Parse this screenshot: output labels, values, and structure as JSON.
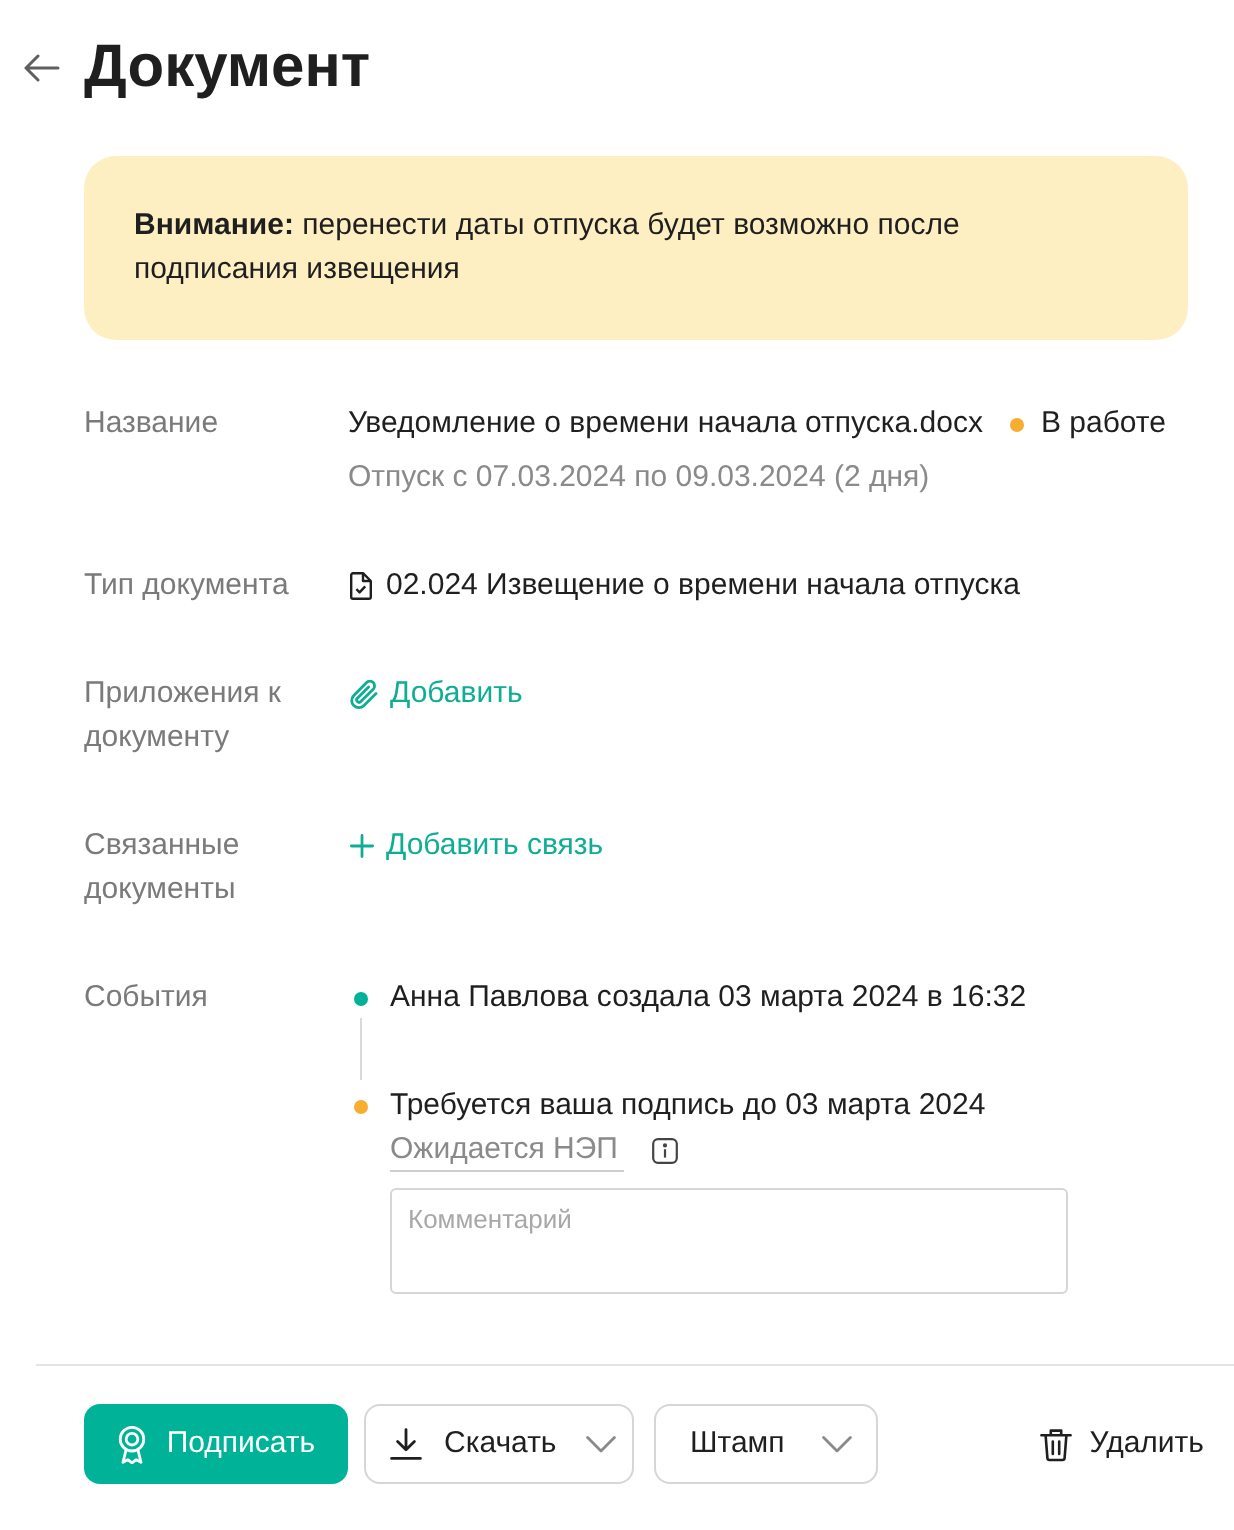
{
  "header": {
    "title": "Документ"
  },
  "alert": {
    "text": "**Внимание:** перенести даты отпуска будет возможно после подписания извещения"
  },
  "fields": [
    {
      "kind": "name",
      "label": "Название",
      "value": "Уведомление о времени начала отпуска.docx",
      "status": "В работе",
      "subtitle": "Отпуск с 07.03.2024 по 09.03.2024 (2 дня)"
    },
    {
      "kind": "doc_type",
      "label": "Тип документа",
      "value": "02.024 Извещение о времени начала отпуска"
    },
    {
      "kind": "attachment",
      "label": "Приложения к документу",
      "link": "Добавить"
    },
    {
      "kind": "relation",
      "label": "Связанные документы",
      "link": "Добавить связь"
    },
    {
      "kind": "events",
      "label": "События",
      "events": [
        {
          "text": "Анна Павлова создала 03 марта 2024 в 16:32",
          "color": "#00b398"
        },
        {
          "text": "Требуется ваша подпись до 03 марта 2024",
          "color": "#f7ad2f",
          "signature": "Ожидается НЭП",
          "comment": {
            "placeholder": "Комментарий"
          }
        }
      ]
    }
  ],
  "actions": [
    {
      "kind": "sign",
      "label": "Подписать",
      "dropdown": false
    },
    {
      "kind": "download",
      "label": "Скачать",
      "dropdown": true
    },
    {
      "kind": "stamp",
      "label": "Штамп",
      "dropdown": true
    },
    {
      "kind": "delete",
      "label": "Удалить",
      "dropdown": false
    }
  ]
}
